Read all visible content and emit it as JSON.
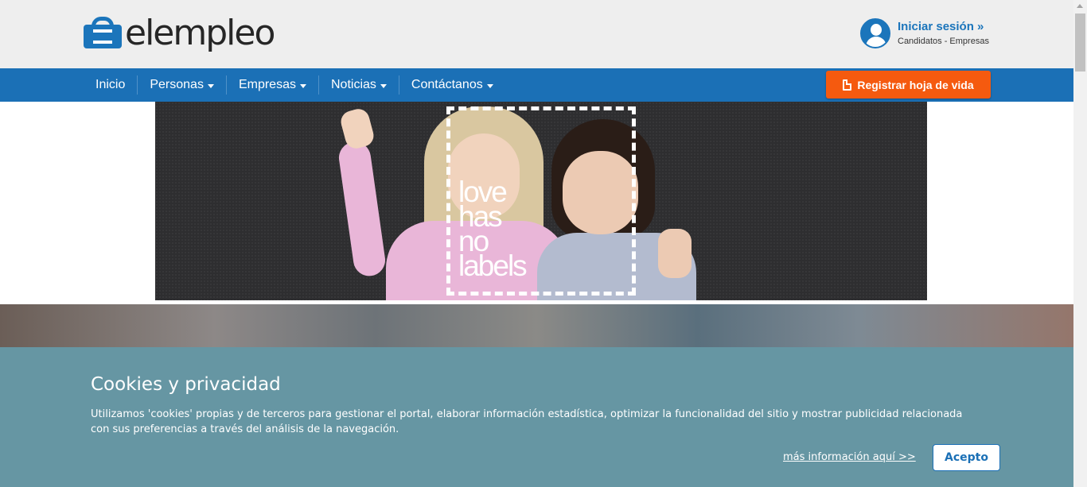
{
  "header": {
    "logo_text": "elempleo",
    "login_title": "Iniciar sesión »",
    "login_sub": "Candidatos - Empresas"
  },
  "nav": {
    "items": [
      {
        "label": "Inicio"
      },
      {
        "label": "Personas"
      },
      {
        "label": "Empresas"
      },
      {
        "label": "Noticias"
      },
      {
        "label": "Contáctanos"
      }
    ],
    "register_label": "Registrar hoja de vida"
  },
  "banner": {
    "lines": [
      "love",
      "has",
      "no",
      "labels"
    ]
  },
  "cookie": {
    "title": "Cookies y privacidad",
    "text": "Utilizamos 'cookies' propias y de terceros para gestionar el portal, elaborar información estadística, optimizar la funcionalidad del sitio y mostrar publicidad relacionada con sus preferencias a través del análisis de la navegación.",
    "link": "más información aquí >>",
    "accept": "Acepto"
  },
  "colors": {
    "brand_blue": "#1b70b6",
    "orange": "#f55a0f",
    "cookie_bg": "#6696a3"
  }
}
